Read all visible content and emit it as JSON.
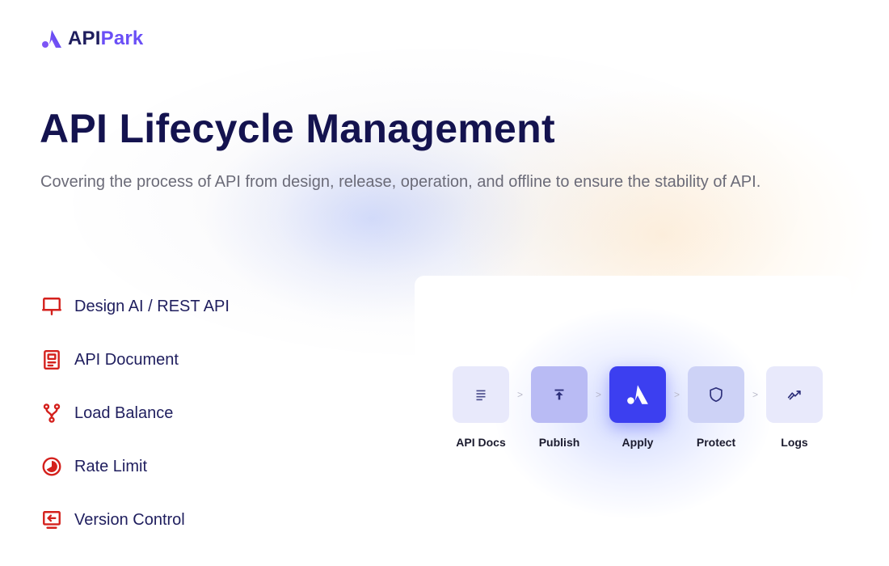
{
  "brand": {
    "name_part1": "API",
    "name_part2": "Park",
    "logo_icon": "apipark-logo-icon",
    "colors": {
      "primary": "#1f1e5e",
      "accent": "#6a4ff6"
    }
  },
  "hero": {
    "title": "API Lifecycle Management",
    "subtitle": "Covering the process of API from design, release, operation, and offline to ensure the stability of API."
  },
  "features": [
    {
      "label": "Design AI / REST API",
      "icon": "monitor-icon"
    },
    {
      "label": "API Document",
      "icon": "document-icon"
    },
    {
      "label": "Load Balance",
      "icon": "branch-icon"
    },
    {
      "label": "Rate Limit",
      "icon": "gauge-icon"
    },
    {
      "label": "Version Control",
      "icon": "version-icon"
    }
  ],
  "feature_icon_color": "#d4201c",
  "lifecycle": {
    "separator": ">",
    "steps": [
      {
        "label": "API Docs",
        "icon": "list-icon",
        "state": "default"
      },
      {
        "label": "Publish",
        "icon": "upload-icon",
        "state": "default"
      },
      {
        "label": "Apply",
        "icon": "apipark-logo-icon",
        "state": "active"
      },
      {
        "label": "Protect",
        "icon": "shield-icon",
        "state": "default"
      },
      {
        "label": "Logs",
        "icon": "trend-icon",
        "state": "default"
      }
    ],
    "active_color": "#3c3ff0"
  }
}
